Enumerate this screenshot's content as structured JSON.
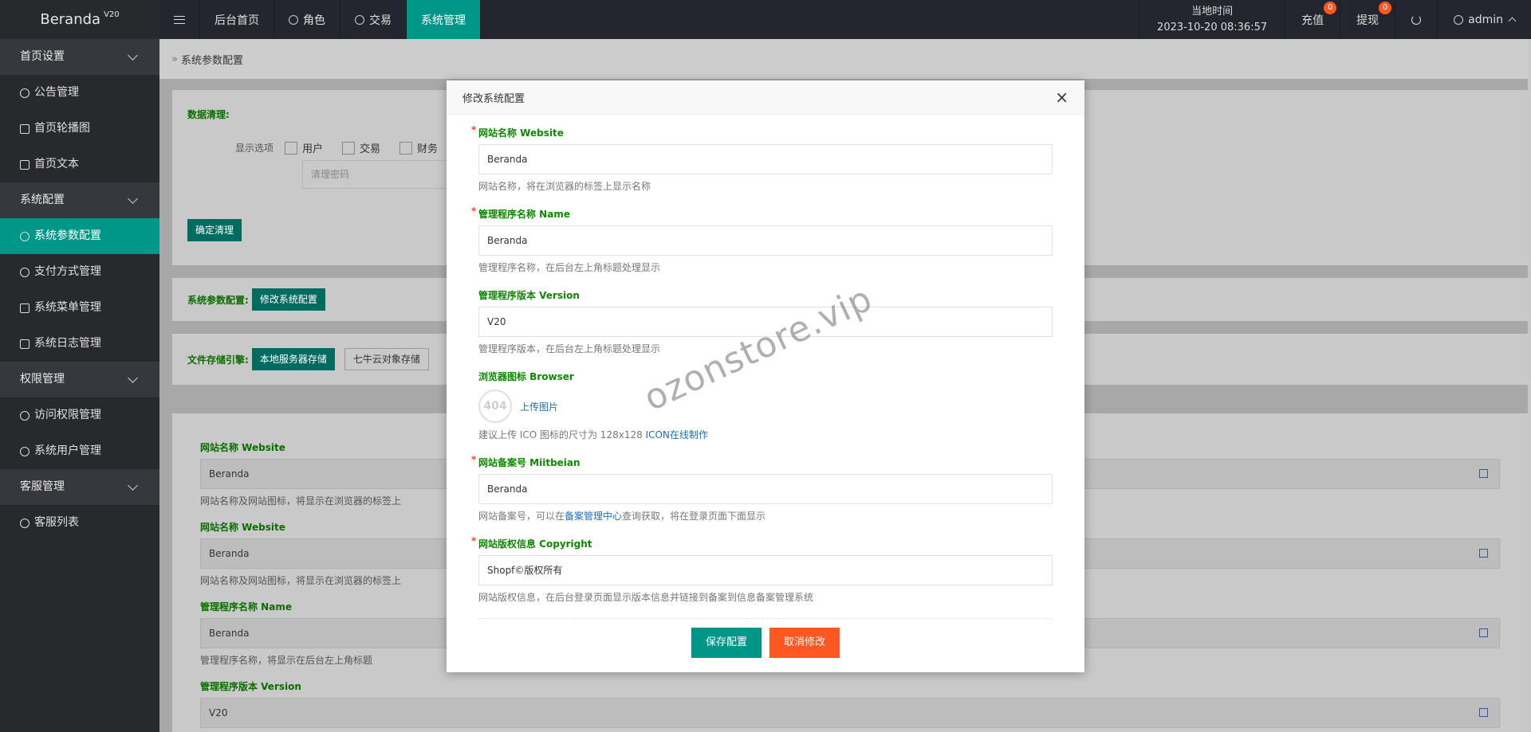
{
  "app": {
    "name": "Beranda",
    "version": "V20"
  },
  "sidebar": {
    "groups": [
      {
        "label": "首页设置",
        "items": [
          "公告管理",
          "首页轮播图",
          "首页文本"
        ]
      },
      {
        "label": "系统配置",
        "items": [
          "系统参数配置",
          "支付方式管理",
          "系统菜单管理",
          "系统日志管理"
        ]
      },
      {
        "label": "权限管理",
        "items": [
          "访问权限管理",
          "系统用户管理"
        ]
      },
      {
        "label": "客服管理",
        "items": [
          "客服列表"
        ]
      }
    ]
  },
  "topbar": {
    "tabs": [
      "后台首页",
      "角色",
      "交易",
      "系统管理"
    ],
    "time_label": "当地时间",
    "time_value": "2023-10-20 08:36:57",
    "recharge": "充值",
    "recharge_count": "0",
    "withdraw": "提现",
    "withdraw_count": "0",
    "user": "admin"
  },
  "page": {
    "breadcrumb": "系统参数配置",
    "data_clean": {
      "title": "数据清理:",
      "options_label": "显示选项",
      "options": [
        "用户",
        "交易",
        "财务"
      ],
      "password_placeholder": "清理密码",
      "confirm_button": "确定清理"
    },
    "sys_params": {
      "label": "系统参数配置:",
      "button": "修改系统配置"
    },
    "storage": {
      "label": "文件存储引擎:",
      "options": [
        "本地服务器存储",
        "七牛云对象存储"
      ]
    },
    "fields": [
      {
        "label": "网站名称 Website",
        "value": "Beranda",
        "hint": "网站名称及网站图标，将显示在浏览器的标签上"
      },
      {
        "label": "网站名称 Website",
        "value": "Beranda",
        "hint": "网站名称及网站图标，将显示在浏览器的标签上"
      },
      {
        "label": "管理程序名称 Name",
        "value": "Beranda",
        "hint": "管理程序名称，将显示在后台左上角标题"
      },
      {
        "label": "管理程序版本 Version",
        "value": "V20"
      }
    ]
  },
  "modal": {
    "title": "修改系统配置",
    "close": "×",
    "website": {
      "label": "网站名称 Website",
      "value": "Beranda",
      "hint": "网站名称，将在浏览器的标签上显示名称"
    },
    "name": {
      "label": "管理程序名称 Name",
      "value": "Beranda",
      "hint": "管理程序名称，在后台左上角标题处理显示"
    },
    "version": {
      "label": "管理程序版本 Version",
      "value": "V20",
      "hint": "管理程序版本，在后台左上角标题处理显示"
    },
    "browser": {
      "label": "浏览器图标 Browser",
      "img_text": "404",
      "upload": "上传图片",
      "hint": "建议上传 ICO 图标的尺寸为 128x128 ",
      "hint_link": "ICON在线制作"
    },
    "miitbeian": {
      "label": "网站备案号 Miitbeian",
      "value": "Beranda",
      "hint_a": "网站备案号，可以在",
      "hint_link": "备案管理中心",
      "hint_b": "查询获取，将在登录页面下面显示"
    },
    "copyright": {
      "label": "网站版权信息 Copyright",
      "value": "Shopf©版权所有",
      "hint": "网站版权信息，在后台登录页面显示版本信息并链接到备案到信息备案管理系统"
    },
    "save": "保存配置",
    "cancel": "取消修改"
  },
  "watermark": "ozonstore.vip",
  "colors": {
    "accent": "#009688",
    "danger": "#ff5722",
    "sidebar": "#28292d",
    "topbar": "#23262e"
  }
}
